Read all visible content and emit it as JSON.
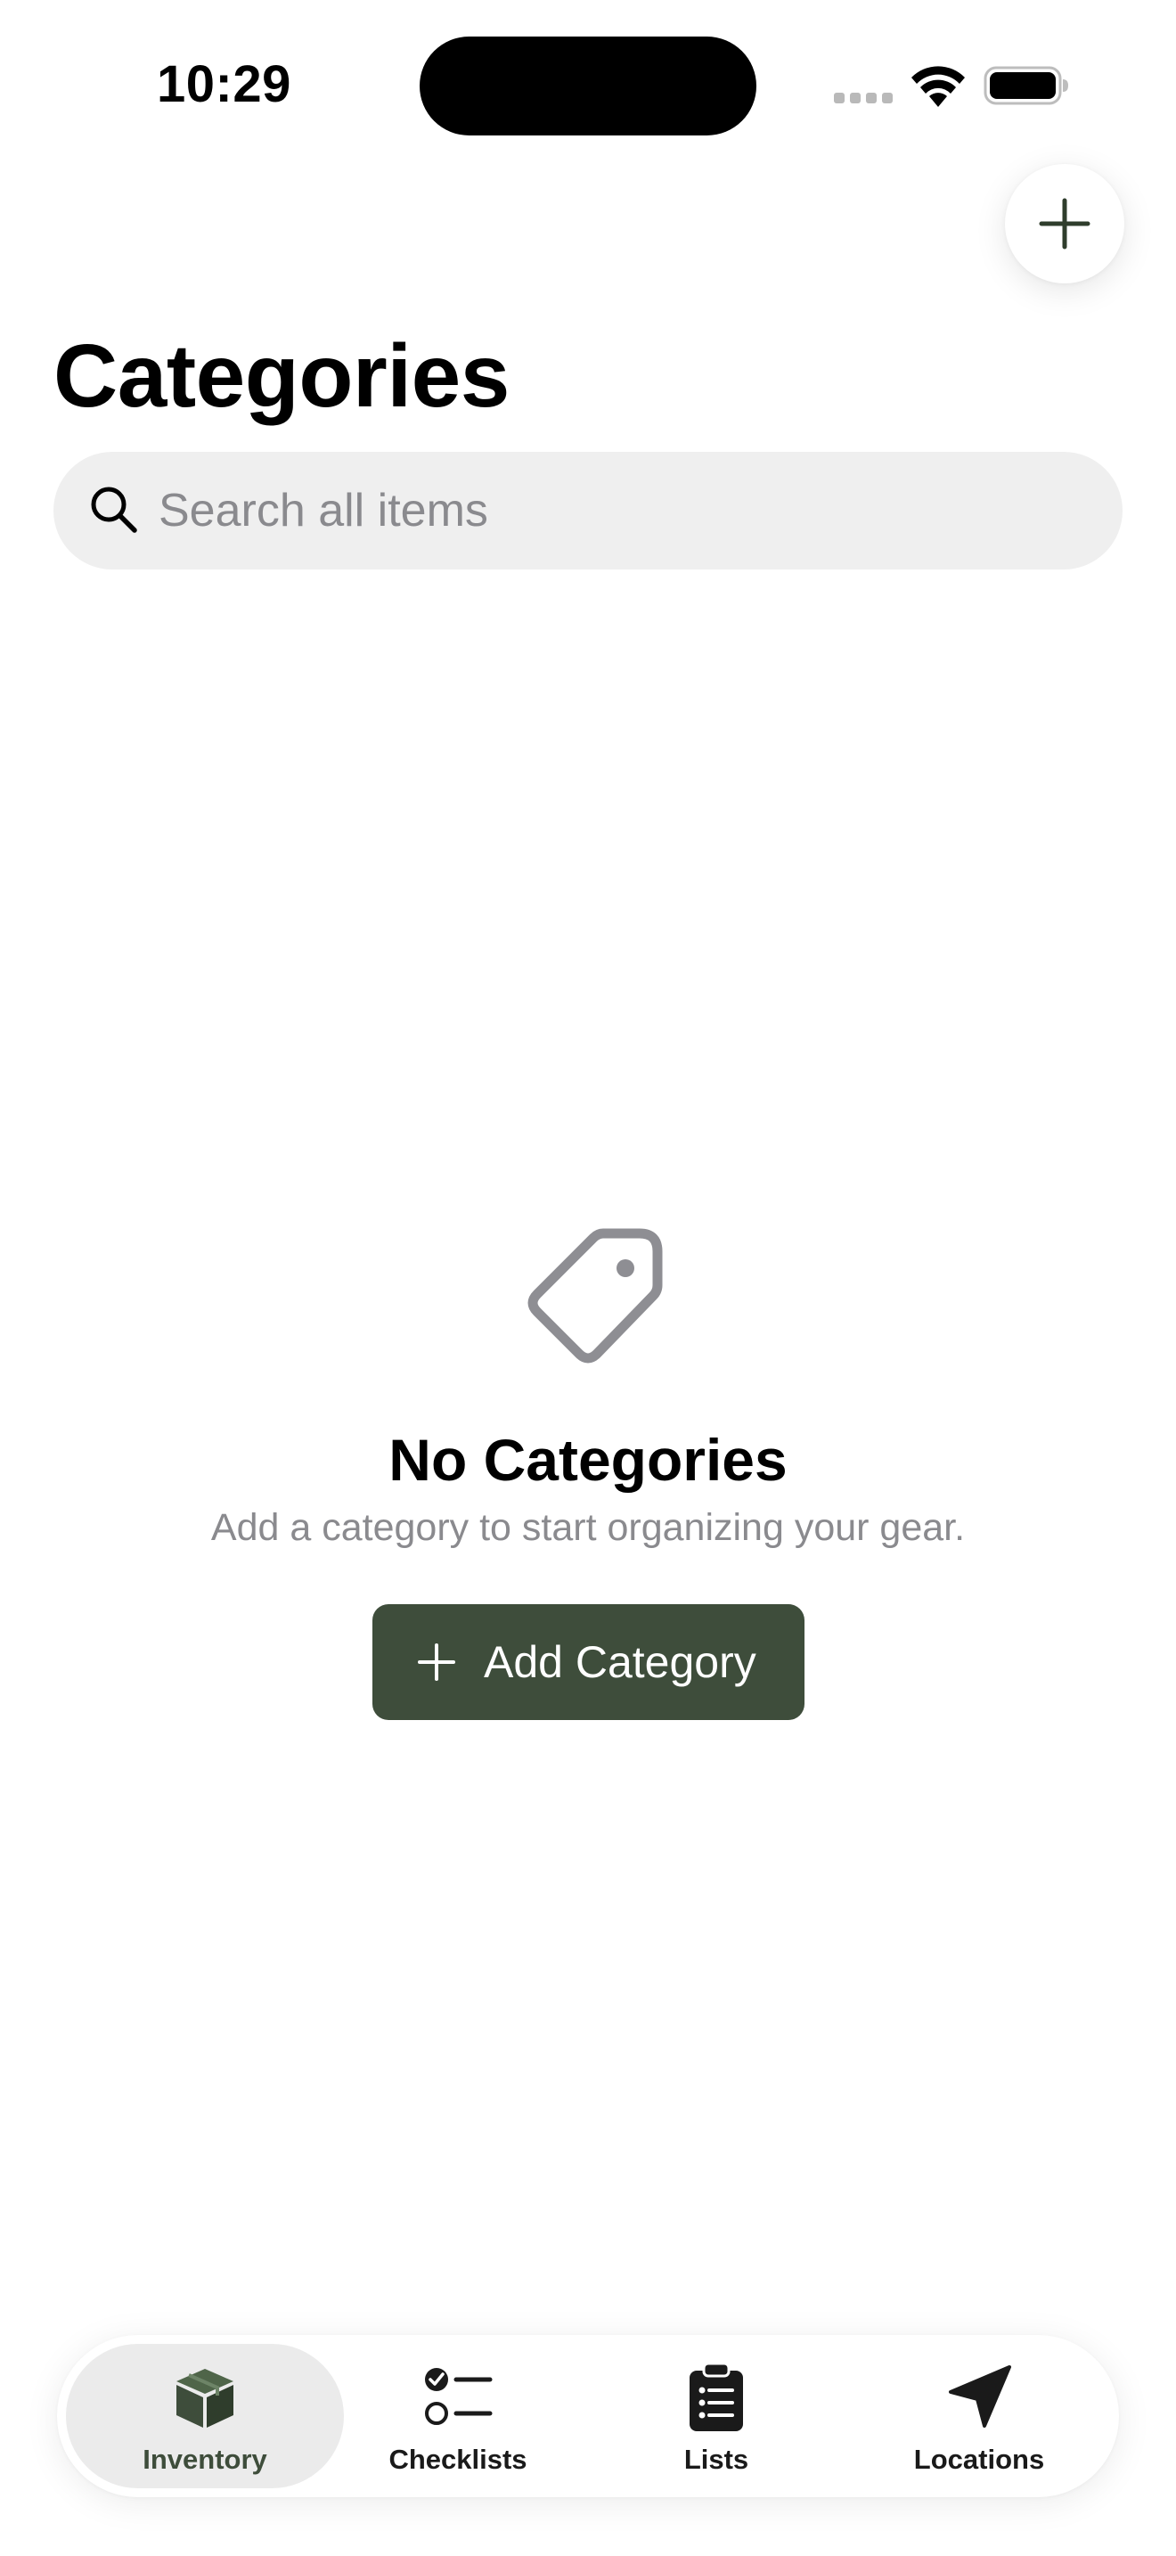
{
  "status_bar": {
    "time": "10:29"
  },
  "header": {
    "title": "Categories"
  },
  "search": {
    "placeholder": "Search all items",
    "value": ""
  },
  "empty_state": {
    "title": "No Categories",
    "subtitle": "Add a category to start organizing your gear.",
    "button_label": "Add Category"
  },
  "tab_bar": {
    "items": [
      {
        "label": "Inventory",
        "icon": "box-icon",
        "selected": true
      },
      {
        "label": "Checklists",
        "icon": "checklist-icon",
        "selected": false
      },
      {
        "label": "Lists",
        "icon": "clipboard-icon",
        "selected": false
      },
      {
        "label": "Locations",
        "icon": "location-arrow-icon",
        "selected": false
      }
    ]
  },
  "colors": {
    "accent": "#3e4d3b",
    "secondary_text": "#8a8a8e",
    "search_background": "#efefef"
  }
}
